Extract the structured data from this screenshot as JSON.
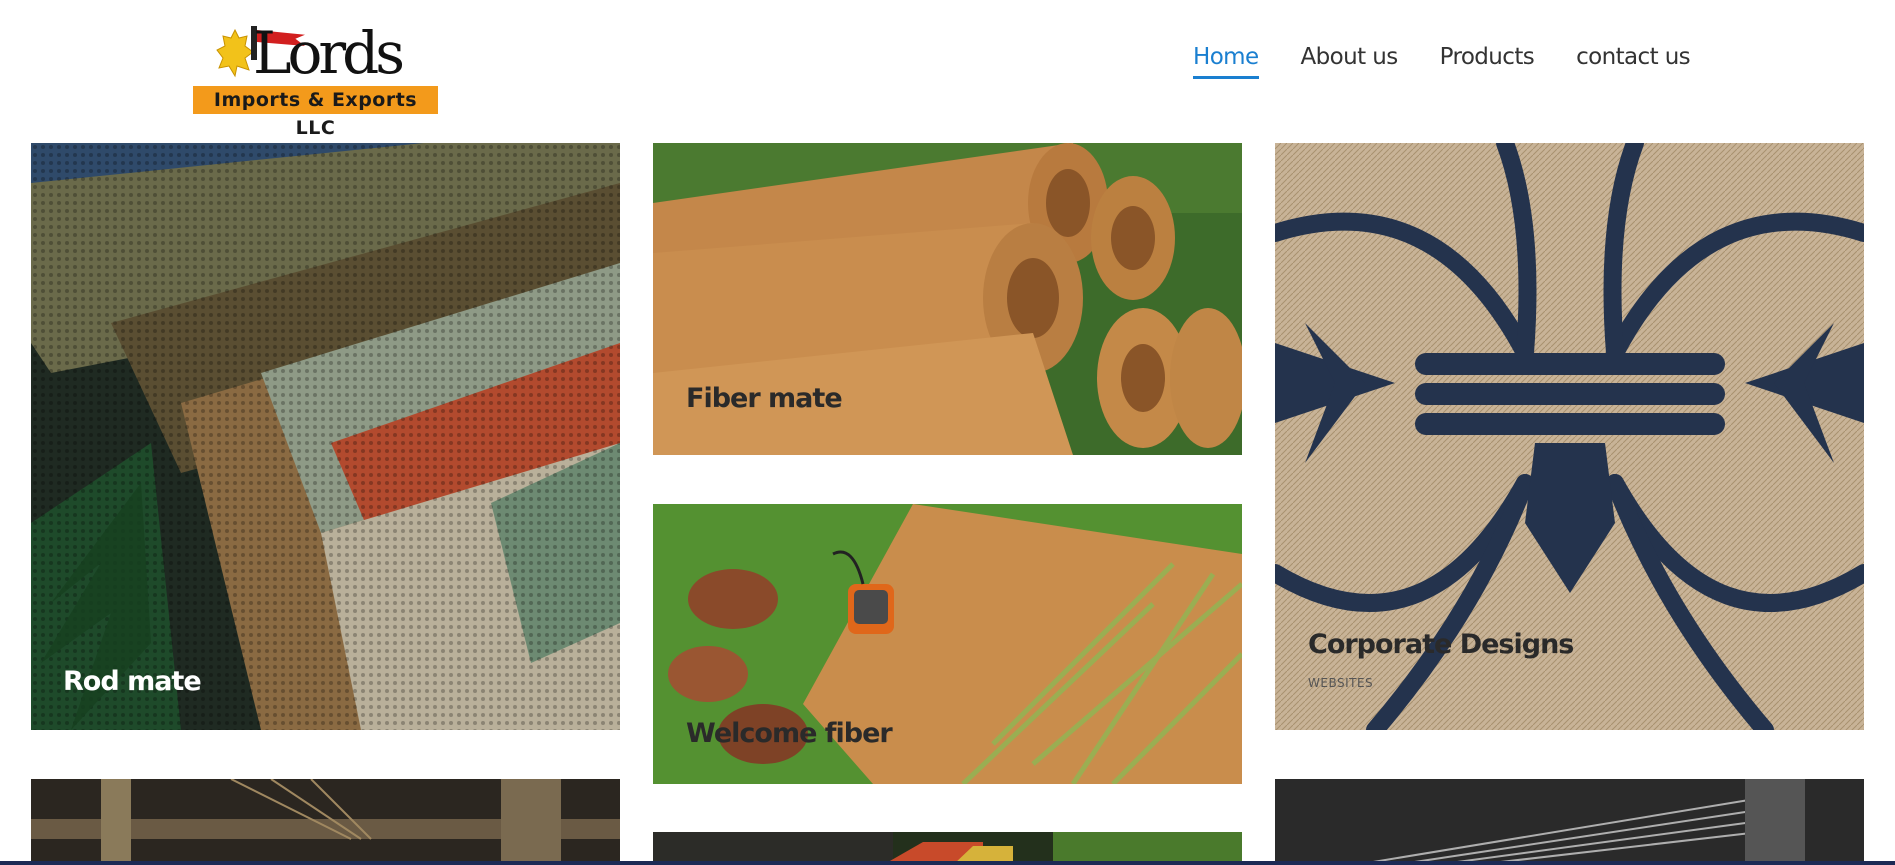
{
  "brand": {
    "logo_word": "Lords",
    "logo_tagline": "Imports & Exports LLC"
  },
  "nav": {
    "items": [
      "Home",
      "About us",
      "Products",
      "contact us"
    ],
    "active": "Home",
    "accent_color": "#1a7fd0"
  },
  "gallery": {
    "tiles": [
      {
        "title": "Rod mate"
      },
      {
        "title": "Fiber mate"
      },
      {
        "title": "Corporate Designs",
        "subtitle": "WEBSITES"
      },
      {
        "title": "Welcome fiber"
      }
    ]
  }
}
